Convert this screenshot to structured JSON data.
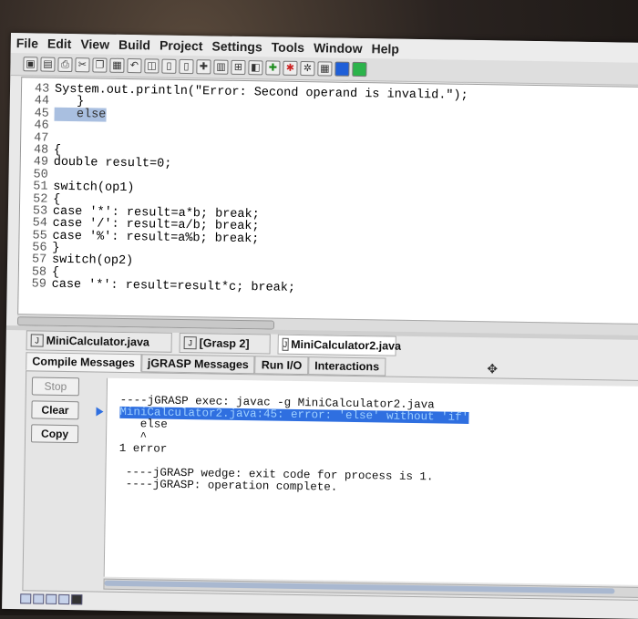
{
  "menu": [
    "File",
    "Edit",
    "View",
    "Build",
    "Project",
    "Settings",
    "Tools",
    "Window",
    "Help"
  ],
  "toolbar_icons": [
    "save-icon",
    "save-all-icon",
    "print-icon",
    "cut-icon",
    "copy-icon",
    "paste-icon",
    "undo-icon",
    "browse-icon",
    "doc-icon",
    "doc2-icon",
    "compile-icon",
    "chart-icon",
    "uml-icon",
    "debug-icon",
    "run-icon",
    "step-icon",
    "bug-icon",
    "grid-icon",
    "blue-square-icon",
    "green-square-icon"
  ],
  "code_lines": [
    {
      "n": "43",
      "text": "System.out.println(\"Error: Second operand is invalid.\");"
    },
    {
      "n": "44",
      "text": "   }"
    },
    {
      "n": "45",
      "text": "   else",
      "highlight": true
    },
    {
      "n": "46",
      "text": ""
    },
    {
      "n": "47",
      "text": ""
    },
    {
      "n": "48",
      "text": "{"
    },
    {
      "n": "49",
      "text": "double result=0;"
    },
    {
      "n": "50",
      "text": ""
    },
    {
      "n": "51",
      "text": "switch(op1)"
    },
    {
      "n": "52",
      "text": "{"
    },
    {
      "n": "53",
      "text": "case '*': result=a*b; break;"
    },
    {
      "n": "54",
      "text": "case '/': result=a/b; break;"
    },
    {
      "n": "55",
      "text": "case '%': result=a%b; break;"
    },
    {
      "n": "56",
      "text": "}"
    },
    {
      "n": "57",
      "text": "switch(op2)"
    },
    {
      "n": "58",
      "text": "{"
    },
    {
      "n": "59",
      "text": "case '*': result=result*c; break;"
    }
  ],
  "file_tabs": [
    "MiniCalculator.java",
    "[Grasp 2]",
    "MiniCalculator2.java"
  ],
  "message_tabs": [
    "Compile Messages",
    "jGRASP Messages",
    "Run I/O",
    "Interactions"
  ],
  "side_buttons": {
    "stop": "Stop",
    "clear": "Clear",
    "copy": "Copy"
  },
  "output_lines": [
    "----jGRASP exec: javac -g MiniCalculator2.java",
    "MiniCalculator2.java:45: error: 'else' without 'if'",
    "   else",
    "   ^",
    "1 error",
    "",
    " ----jGRASP wedge: exit code for process is 1.",
    " ----jGRASP: operation complete."
  ],
  "colors": {
    "keyword": "#8b1a6b",
    "string": "#2d5ca8",
    "error_highlight": "#2f6fe0"
  }
}
